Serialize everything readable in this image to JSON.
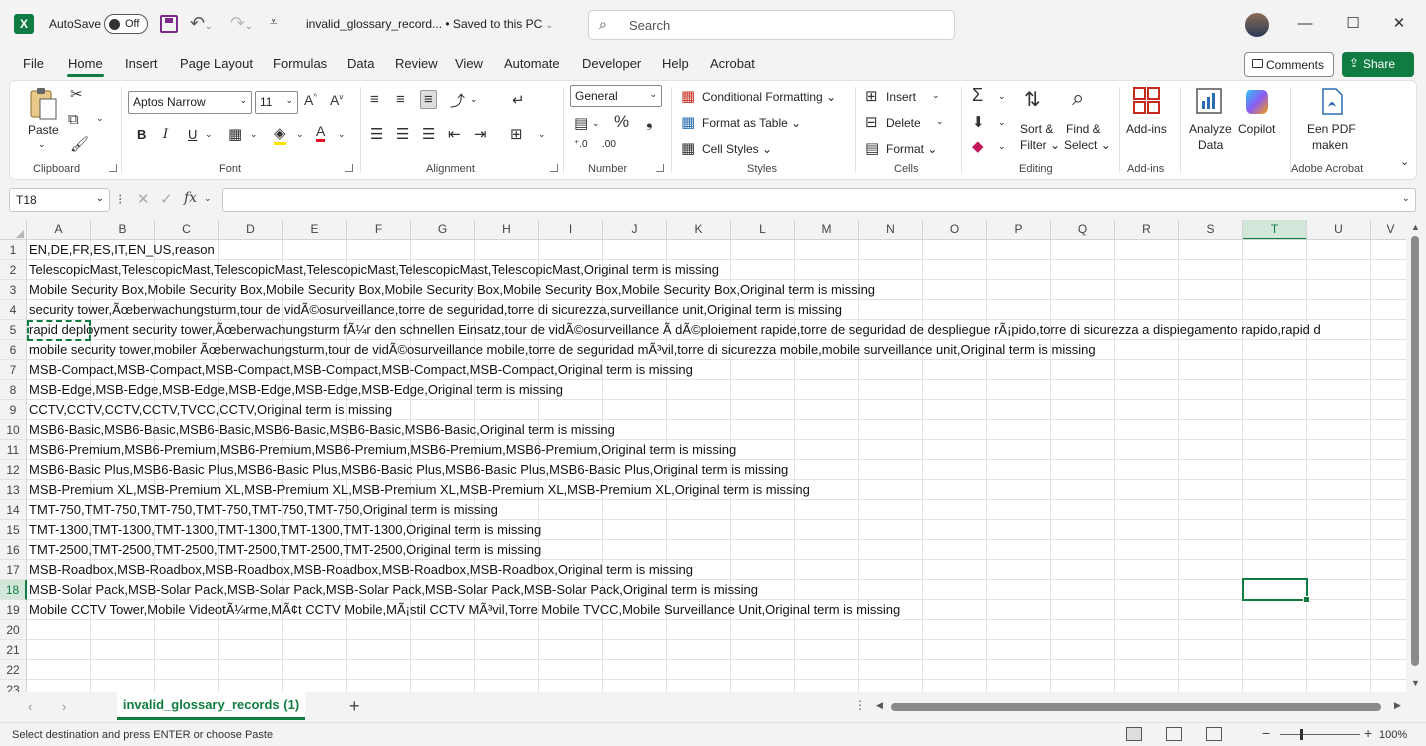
{
  "titlebar": {
    "app_letter": "X",
    "autosave_label": "AutoSave",
    "autosave_state": "Off",
    "document_title": "invalid_glossary_record...  •  Saved to this PC",
    "search_placeholder": "Search"
  },
  "menu": {
    "tabs": [
      "File",
      "Home",
      "Insert",
      "Page Layout",
      "Formulas",
      "Data",
      "Review",
      "View",
      "Automate",
      "Developer",
      "Help",
      "Acrobat"
    ],
    "active_tab": "Home",
    "comments_label": "Comments",
    "share_label": "Share"
  },
  "ribbon": {
    "clipboard": {
      "label": "Clipboard",
      "paste": "Paste"
    },
    "font": {
      "label": "Font",
      "font_name": "Aptos Narrow",
      "font_size": "11",
      "bold": "B",
      "italic": "I",
      "underline": "U"
    },
    "alignment": {
      "label": "Alignment"
    },
    "number": {
      "label": "Number",
      "format": "General"
    },
    "styles": {
      "label": "Styles",
      "conditional": "Conditional Formatting",
      "format_table": "Format as Table",
      "cell_styles": "Cell Styles"
    },
    "cells": {
      "label": "Cells",
      "insert": "Insert",
      "delete": "Delete",
      "format": "Format"
    },
    "editing": {
      "label": "Editing",
      "sort_filter_1": "Sort &",
      "sort_filter_2": "Filter",
      "find_select_1": "Find &",
      "find_select_2": "Select"
    },
    "addins": {
      "label": "Add-ins",
      "addins_btn": "Add-ins"
    },
    "analyze": {
      "line1": "Analyze",
      "line2": "Data"
    },
    "copilot": {
      "label": "Copilot"
    },
    "acrobat": {
      "label": "Adobe Acrobat",
      "line1": "Een PDF",
      "line2": "maken"
    }
  },
  "formula_bar": {
    "name_box": "T18",
    "fx": "fx",
    "value": ""
  },
  "grid": {
    "columns": [
      "A",
      "B",
      "C",
      "D",
      "E",
      "F",
      "G",
      "H",
      "I",
      "J",
      "K",
      "L",
      "M",
      "N",
      "O",
      "P",
      "Q",
      "R",
      "S",
      "T",
      "U",
      "V"
    ],
    "selected_column": "T",
    "selected_row": "18",
    "rows": [
      {
        "num": "1",
        "text": "EN,DE,FR,ES,IT,EN_US,reason"
      },
      {
        "num": "2",
        "text": "TelescopicMast,TelescopicMast,TelescopicMast,TelescopicMast,TelescopicMast,TelescopicMast,Original term is missing"
      },
      {
        "num": "3",
        "text": "Mobile Security Box,Mobile Security Box,Mobile Security Box,Mobile Security Box,Mobile Security Box,Mobile Security Box,Original term is missing"
      },
      {
        "num": "4",
        "text": "security tower,Ãœberwachungsturm,tour de vidÃ©osurveillance,torre de seguridad,torre di sicurezza,surveillance unit,Original term is missing"
      },
      {
        "num": "5",
        "text": "rapid deployment security tower,Ãœberwachungsturm fÃ¼r den schnellen Einsatz,tour de vidÃ©osurveillance Ã  dÃ©ploiement rapide,torre de seguridad de despliegue rÃ¡pido,torre di sicurezza a dispiegamento rapido,rapid d"
      },
      {
        "num": "6",
        "text": "mobile security tower,mobiler Ãœberwachungsturm,tour de vidÃ©osurveillance mobile,torre de seguridad mÃ³vil,torre di sicurezza mobile,mobile surveillance unit,Original term is missing"
      },
      {
        "num": "7",
        "text": "MSB-Compact,MSB-Compact,MSB-Compact,MSB-Compact,MSB-Compact,MSB-Compact,Original term is missing"
      },
      {
        "num": "8",
        "text": "MSB-Edge,MSB-Edge,MSB-Edge,MSB-Edge,MSB-Edge,MSB-Edge,Original term is missing"
      },
      {
        "num": "9",
        "text": "CCTV,CCTV,CCTV,CCTV,TVCC,CCTV,Original term is missing"
      },
      {
        "num": "10",
        "text": "MSB6-Basic,MSB6-Basic,MSB6-Basic,MSB6-Basic,MSB6-Basic,MSB6-Basic,Original term is missing"
      },
      {
        "num": "11",
        "text": "MSB6-Premium,MSB6-Premium,MSB6-Premium,MSB6-Premium,MSB6-Premium,MSB6-Premium,Original term is missing"
      },
      {
        "num": "12",
        "text": "MSB6-Basic Plus,MSB6-Basic Plus,MSB6-Basic Plus,MSB6-Basic Plus,MSB6-Basic Plus,MSB6-Basic Plus,Original term is missing"
      },
      {
        "num": "13",
        "text": "MSB-Premium XL,MSB-Premium XL,MSB-Premium XL,MSB-Premium XL,MSB-Premium XL,MSB-Premium XL,Original term is missing"
      },
      {
        "num": "14",
        "text": "TMT-750,TMT-750,TMT-750,TMT-750,TMT-750,TMT-750,Original term is missing"
      },
      {
        "num": "15",
        "text": "TMT-1300,TMT-1300,TMT-1300,TMT-1300,TMT-1300,TMT-1300,Original term is missing"
      },
      {
        "num": "16",
        "text": "TMT-2500,TMT-2500,TMT-2500,TMT-2500,TMT-2500,TMT-2500,Original term is missing"
      },
      {
        "num": "17",
        "text": "MSB-Roadbox,MSB-Roadbox,MSB-Roadbox,MSB-Roadbox,MSB-Roadbox,MSB-Roadbox,Original term is missing"
      },
      {
        "num": "18",
        "text": "MSB-Solar Pack,MSB-Solar Pack,MSB-Solar Pack,MSB-Solar Pack,MSB-Solar Pack,MSB-Solar Pack,Original term is missing"
      },
      {
        "num": "19",
        "text": "Mobile CCTV Tower,Mobile VideotÃ¼rme,MÃ¢t CCTV Mobile,MÃ¡stil CCTV MÃ³vil,Torre Mobile TVCC,Mobile Surveillance Unit,Original term is missing"
      },
      {
        "num": "20",
        "text": ""
      },
      {
        "num": "21",
        "text": ""
      },
      {
        "num": "22",
        "text": ""
      },
      {
        "num": "23",
        "text": ""
      }
    ]
  },
  "sheet_tabs": {
    "active": "invalid_glossary_records (1)"
  },
  "status": {
    "message": "Select destination and press ENTER or choose Paste",
    "zoom": "100%"
  },
  "colors": {
    "accent": "#107c41"
  }
}
